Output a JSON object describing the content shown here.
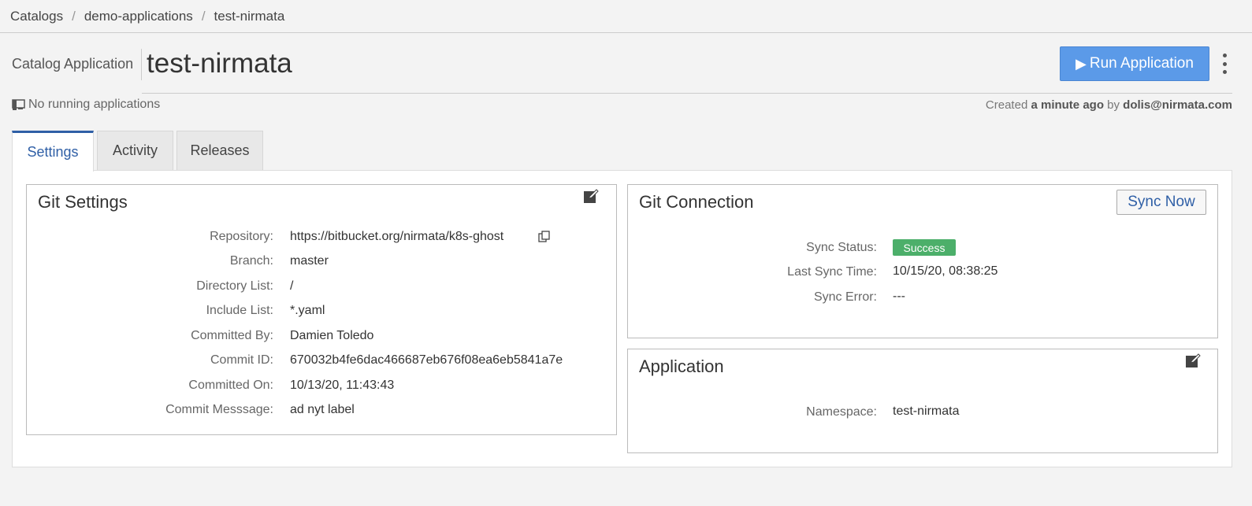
{
  "breadcrumb": {
    "items": [
      "Catalogs",
      "demo-applications",
      "test-nirmata"
    ],
    "separator": "/"
  },
  "header": {
    "catalog_label": "Catalog Application",
    "title": "test-nirmata",
    "run_button_label": "Run Application",
    "running_status": "No running applications",
    "created_prefix": "Created",
    "created_time": "a minute ago",
    "created_by_word": "by",
    "created_by": "dolis@nirmata.com"
  },
  "tabs": [
    {
      "label": "Settings",
      "active": true
    },
    {
      "label": "Activity",
      "active": false
    },
    {
      "label": "Releases",
      "active": false
    }
  ],
  "git_settings": {
    "title": "Git Settings",
    "rows": [
      {
        "label": "Repository:",
        "value": "https://bitbucket.org/nirmata/k8s-ghost"
      },
      {
        "label": "Branch:",
        "value": "master"
      },
      {
        "label": "Directory List:",
        "value": "/"
      },
      {
        "label": "Include List:",
        "value": "*.yaml"
      },
      {
        "label": "Committed By:",
        "value": "Damien Toledo"
      },
      {
        "label": "Commit ID:",
        "value": "670032b4fe6dac466687eb676f08ea6eb5841a7e"
      },
      {
        "label": "Committed On:",
        "value": "10/13/20, 11:43:43"
      },
      {
        "label": "Commit Messsage:",
        "value": "ad nyt label"
      }
    ]
  },
  "git_connection": {
    "title": "Git Connection",
    "sync_button_label": "Sync Now",
    "sync_status_label": "Sync Status:",
    "sync_status_value": "Success",
    "last_sync_label": "Last Sync Time:",
    "last_sync_value": "10/15/20, 08:38:25",
    "sync_error_label": "Sync Error:",
    "sync_error_value": "---"
  },
  "application": {
    "title": "Application",
    "namespace_label": "Namespace:",
    "namespace_value": "test-nirmata"
  },
  "colors": {
    "accent": "#2f5fa6",
    "primary_button": "#5b9ae8",
    "success": "#4caf6a"
  },
  "icons": {
    "running": "app-icon",
    "copy": "copy-icon",
    "edit": "edit-icon",
    "play": "play-icon",
    "more": "more-vertical-icon"
  }
}
